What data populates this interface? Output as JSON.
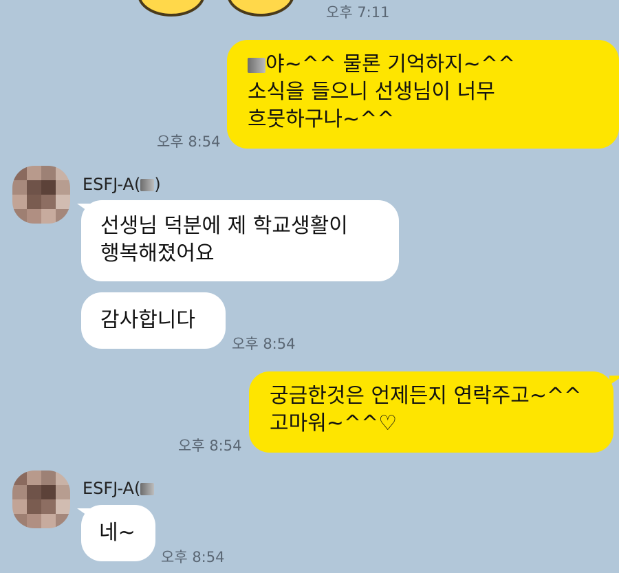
{
  "chat": {
    "bg_color": "#b2c7d9",
    "my_bubble_color": "#fee500",
    "other_bubble_color": "#ffffff",
    "messages": [
      {
        "id": 0,
        "sender": "me",
        "time": "오후 7:11"
      },
      {
        "id": 1,
        "sender": "me",
        "time": "오후 8:54",
        "lines": [
          "야~^^ 물론 기억하지~^^",
          "소식을 들으니 선생님이 너무",
          "흐뭇하구나~^^"
        ]
      },
      {
        "id": 2,
        "sender": "other",
        "name_prefix": "ESFJ-A(",
        "name_suffix": ")",
        "lines": [
          "선생님 덕분에 제 학교생활이",
          "행복해졌어요"
        ]
      },
      {
        "id": 3,
        "sender": "other",
        "time": "오후 8:54",
        "lines": [
          "감사합니다"
        ]
      },
      {
        "id": 4,
        "sender": "me",
        "time": "오후 8:54",
        "lines": [
          "궁금한것은 언제든지 연락주고~^^",
          "고마워~^^♡"
        ]
      },
      {
        "id": 5,
        "sender": "other",
        "name_prefix": "ESFJ-A(",
        "time": "오후 8:54",
        "lines": [
          "네~"
        ]
      }
    ]
  }
}
